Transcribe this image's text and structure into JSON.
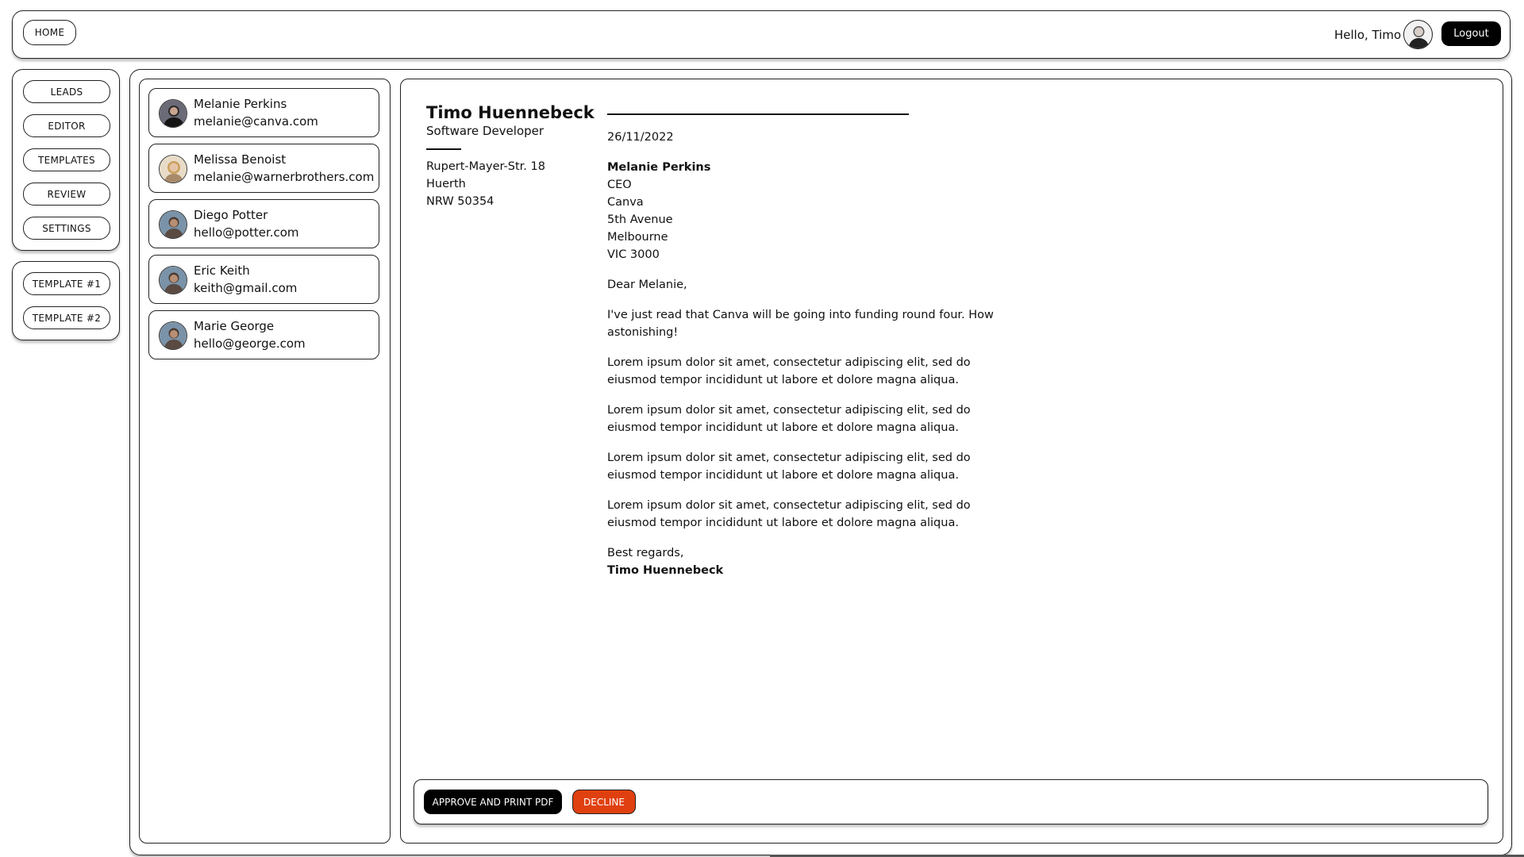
{
  "header": {
    "home_label": "HOME",
    "greeting": "Hello, Timo",
    "avatar_icon": "user-avatar-icon",
    "logout_label": "Logout"
  },
  "nav": {
    "items": [
      {
        "label": "LEADS"
      },
      {
        "label": "EDITOR"
      },
      {
        "label": "TEMPLATES"
      },
      {
        "label": "REVIEW"
      },
      {
        "label": "SETTINGS"
      }
    ],
    "templates": [
      {
        "label": "TEMPLATE #1"
      },
      {
        "label": "TEMPLATE #2"
      }
    ]
  },
  "contacts": [
    {
      "name": "Melanie Perkins",
      "email": "melanie@canva.com"
    },
    {
      "name": "Melissa Benoist",
      "email": "melanie@warnerbrothers.com"
    },
    {
      "name": "Diego Potter",
      "email": "hello@potter.com"
    },
    {
      "name": "Eric Keith",
      "email": "keith@gmail.com"
    },
    {
      "name": "Marie George",
      "email": "hello@george.com"
    }
  ],
  "sender": {
    "name": "Timo Huennebeck",
    "title": "Software Developer",
    "address": [
      "Rupert-Mayer-Str. 18",
      "Huerth",
      "NRW 50354"
    ]
  },
  "letter": {
    "date": "26/11/2022",
    "recipient": {
      "name": "Melanie Perkins",
      "lines": [
        "CEO",
        "Canva",
        "5th Avenue",
        "Melbourne",
        "VIC 3000"
      ]
    },
    "salutation": "Dear Melanie,",
    "paragraphs": [
      "I've just read that Canva will be going into funding round four. How astonishing!",
      "Lorem ipsum dolor sit amet, consectetur adipiscing elit, sed do eiusmod tempor incididunt ut labore et dolore magna aliqua.",
      "Lorem ipsum dolor sit amet, consectetur adipiscing elit, sed do eiusmod tempor incididunt ut labore et dolore magna aliqua.",
      "Lorem ipsum dolor sit amet, consectetur adipiscing elit, sed do eiusmod tempor incididunt ut labore et dolore magna aliqua.",
      "Lorem ipsum dolor sit amet, consectetur adipiscing elit, sed do eiusmod tempor incididunt ut labore et dolore magna aliqua."
    ],
    "closing": "Best regards,",
    "signature": "Timo Huennebeck"
  },
  "actions": {
    "approve_label": "APPROVE AND PRINT PDF",
    "decline_label": "DECLINE"
  },
  "colors": {
    "primary_button": "#000000",
    "decline_button": "#e0400f"
  }
}
